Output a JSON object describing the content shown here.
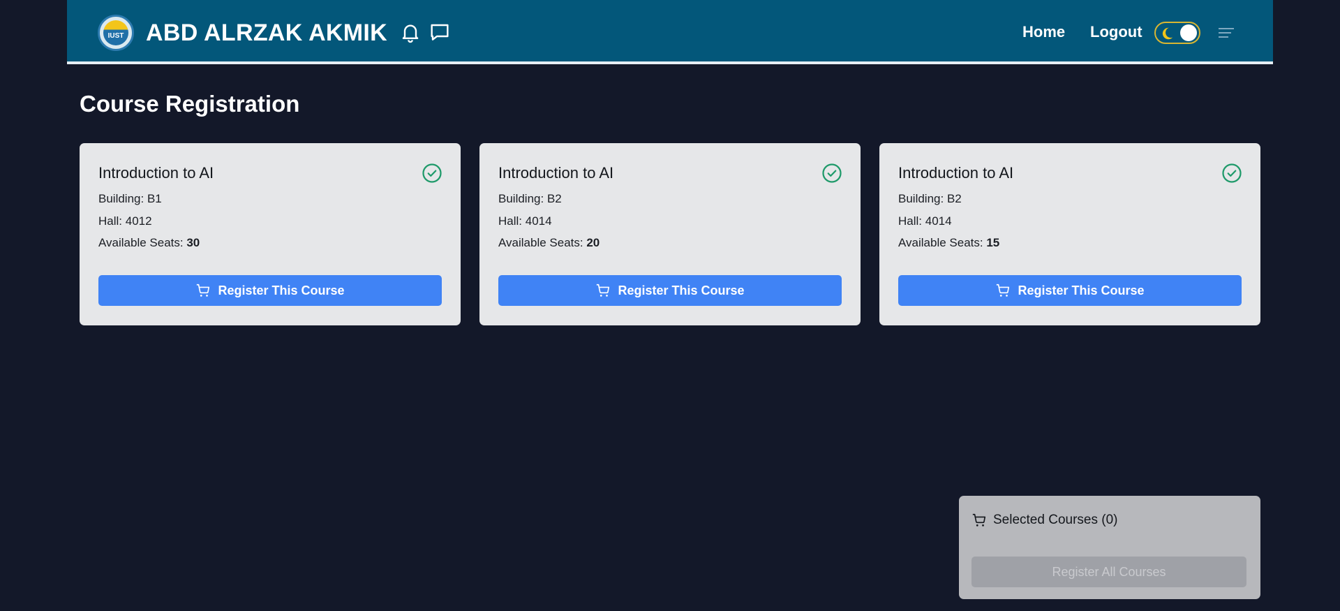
{
  "header": {
    "logo_text": "IUST",
    "user_name": "ABD ALRZAK AKMIK",
    "nav": {
      "home": "Home",
      "logout": "Logout"
    }
  },
  "icons": {
    "bell": "bell-icon",
    "message": "message-icon",
    "theme_toggle": "moon-icon",
    "menu": "menu-icon",
    "check": "check-circle-icon",
    "cart": "cart-icon"
  },
  "page": {
    "title": "Course Registration"
  },
  "labels": {
    "building": "Building:",
    "hall": "Hall:",
    "seats": "Available Seats:"
  },
  "courses": [
    {
      "title": "Introduction to AI",
      "building": "B1",
      "hall": "4012",
      "seats": "30",
      "button": "Register This Course"
    },
    {
      "title": "Introduction to AI",
      "building": "B2",
      "hall": "4014",
      "seats": "20",
      "button": "Register This Course"
    },
    {
      "title": "Introduction to AI",
      "building": "B2",
      "hall": "4014",
      "seats": "15",
      "button": "Register This Course"
    }
  ],
  "selected": {
    "title": "Selected Courses (0)",
    "button": "Register All Courses"
  },
  "colors": {
    "background": "#131829",
    "navbar": "#03577a",
    "accent": "#4083f5",
    "check": "#1f9a6a"
  }
}
